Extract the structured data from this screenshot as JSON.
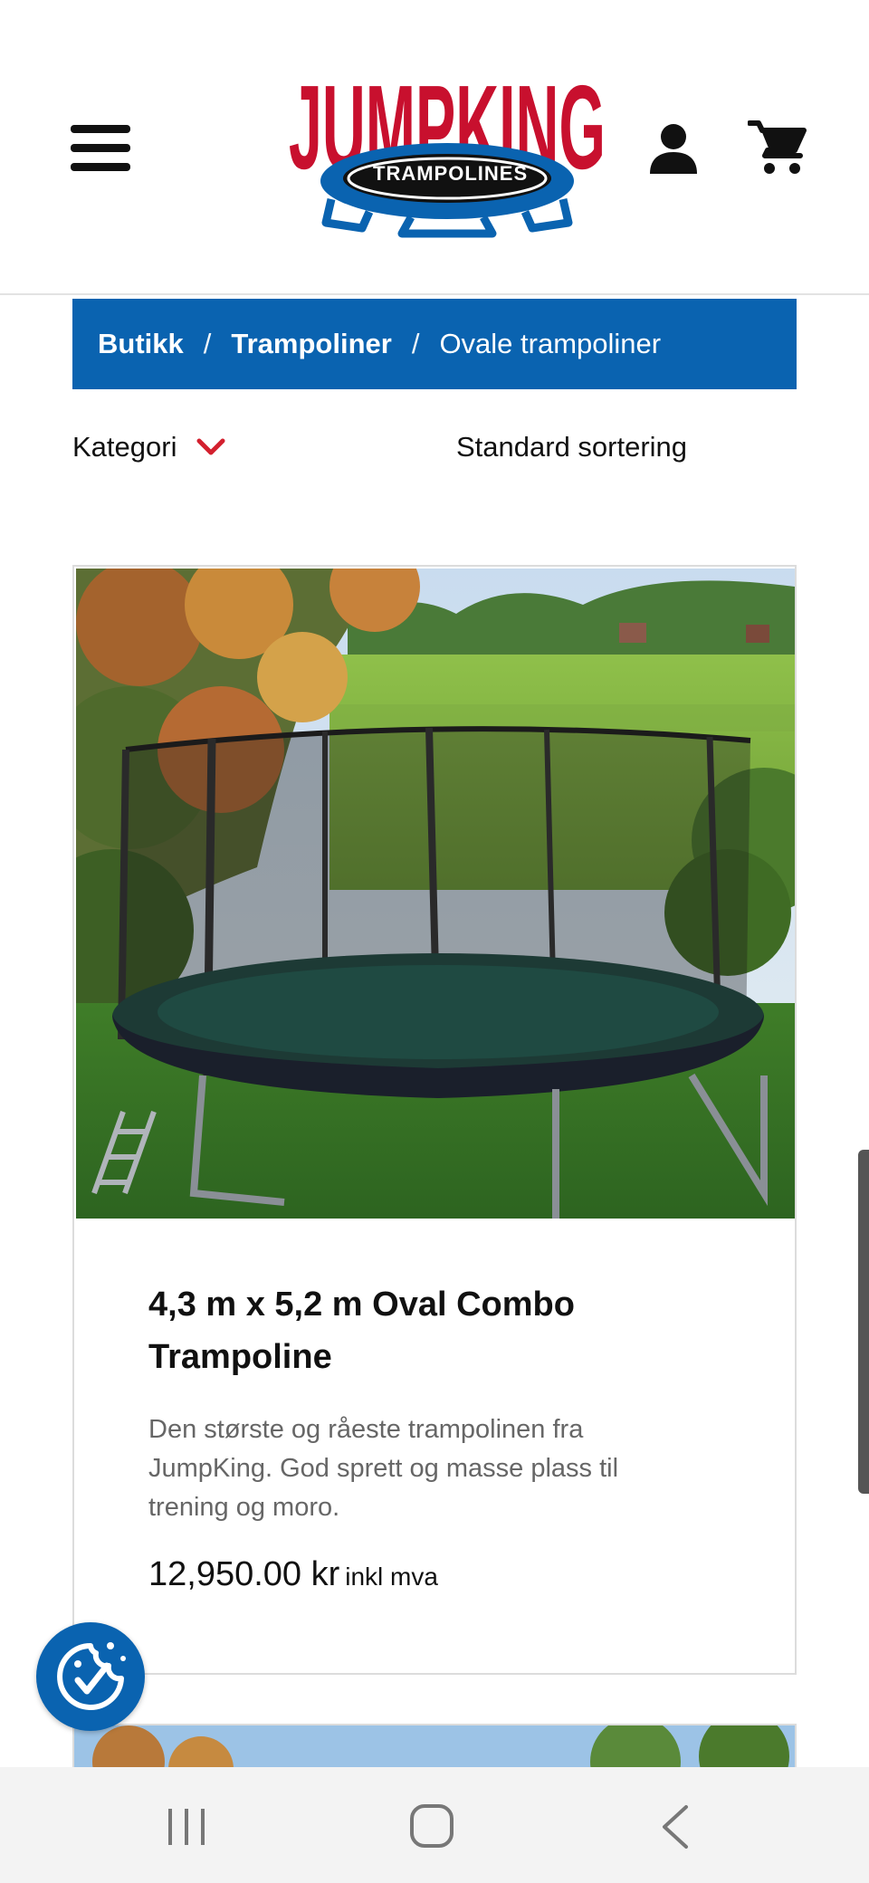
{
  "header": {
    "logo_text": "JUMPKING",
    "logo_subtext": "TRAMPOLINES",
    "brand_red": "#c8102e",
    "brand_blue": "#0a63b0",
    "menu_icon": "hamburger-icon",
    "account_icon": "user-icon",
    "cart_icon": "cart-icon"
  },
  "breadcrumb": {
    "items": [
      "Butikk",
      "Trampoliner",
      "Ovale trampoliner"
    ],
    "separator": "/"
  },
  "filters": {
    "category_label": "Kategori",
    "sort_label": "Standard sortering"
  },
  "products": [
    {
      "title": "4,3 m x 5,2 m Oval Combo Trampoline",
      "description": "Den største og råeste trampolinen fra JumpKing. God sprett og masse plass til trening og moro.",
      "price": "12,950.00 kr",
      "price_suffix": "inkl mva"
    }
  ],
  "system_nav": {
    "recent_icon": "recent-apps-icon",
    "home_icon": "home-icon",
    "back_icon": "back-icon"
  }
}
